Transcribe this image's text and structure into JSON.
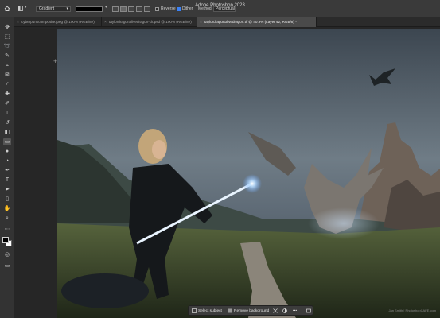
{
  "window": {
    "title": "Adobe Photoshop 2023"
  },
  "options": {
    "gradient_label": "Gradient",
    "reverse_label": "Reverse",
    "dither_label": "Dither",
    "method_label": "Method:",
    "method_value": "Perceptual",
    "reverse_checked": false,
    "dither_checked": true
  },
  "tabs": [
    {
      "label": "cyberpunkcomposite.jpeg @ 100% (RGB/8#)"
    },
    {
      "label": "taylordragon3livedragon-clt.psd @ 100% (RGB/8#)"
    },
    {
      "label": "taylordragon3livedragon.tif @ 40.9% (Layer 42, RGB/8) *"
    }
  ],
  "taskbar": {
    "select_subject": "Select subject",
    "remove_background": "Remove background",
    "more": "•••"
  },
  "watermark": "Jan Smith | PhotoshopCAFE.com",
  "colors": {
    "accent": "#3b82f6",
    "ui_dark": "#282828",
    "panel": "#333333"
  }
}
